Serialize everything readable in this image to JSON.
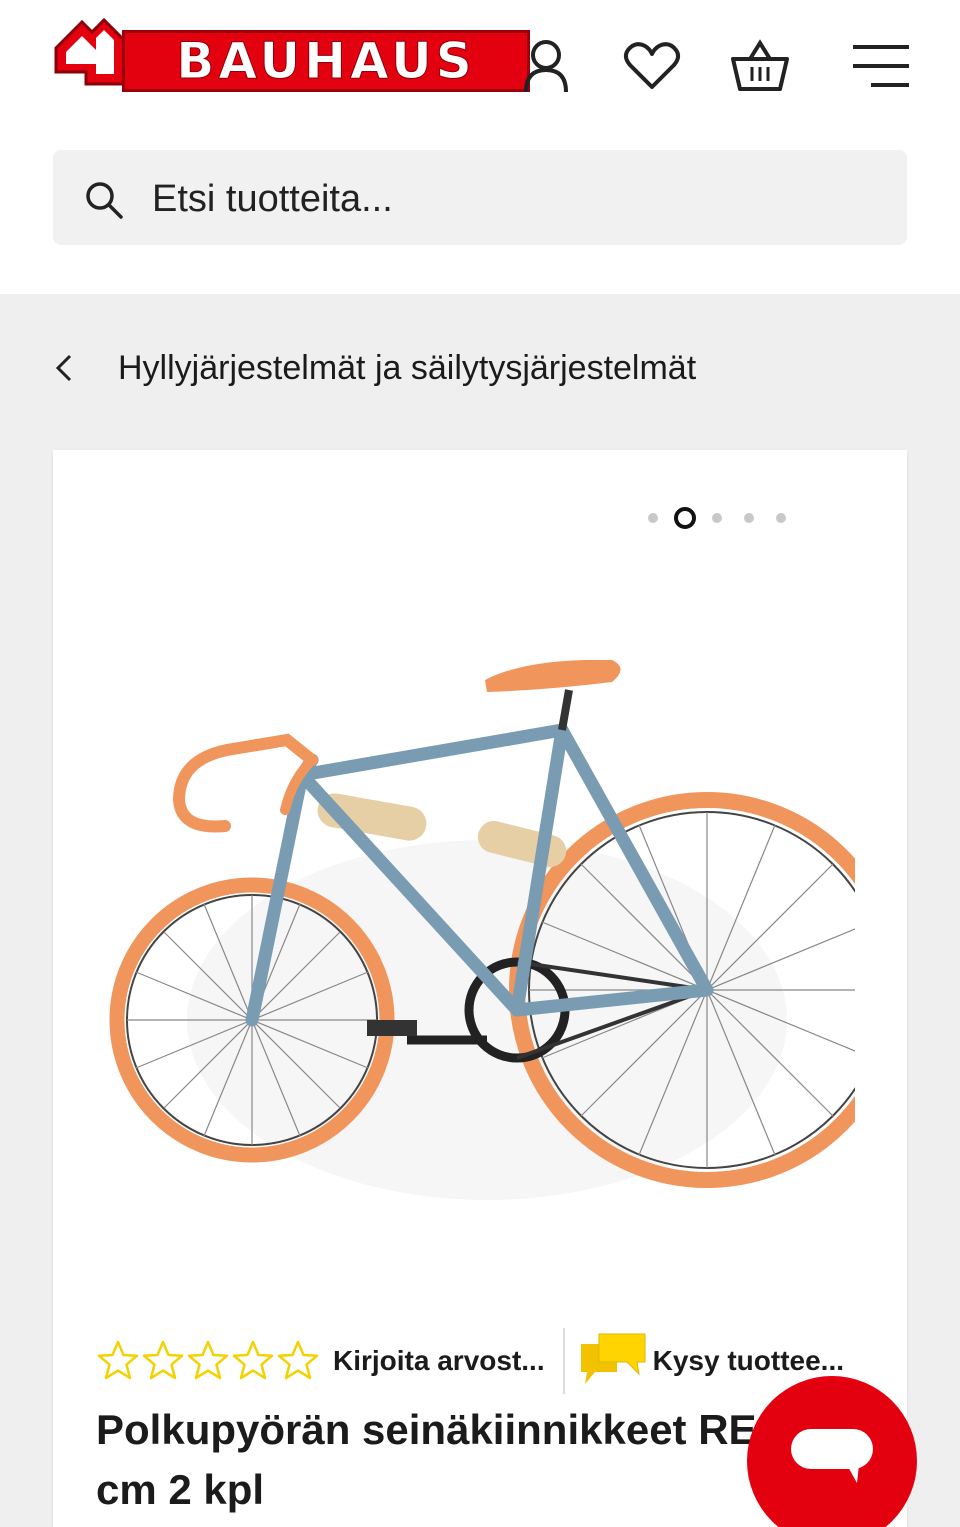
{
  "header": {
    "logo_text": "BAUHAUS",
    "icons": [
      "user-icon",
      "heart-icon",
      "basket-icon",
      "menu-icon"
    ]
  },
  "search": {
    "placeholder": "Etsi tuotteita..."
  },
  "breadcrumb": {
    "label": "Hyllyjärjestelmät ja säilytysjärjestelmät"
  },
  "gallery": {
    "total_images": 5,
    "active_index": 2
  },
  "product": {
    "rating_stars": 0,
    "rating_max": 5,
    "review_link": "Kirjoita arvost...",
    "question_link": "Kysy tuottee...",
    "title": "Polkupyörän seinäkiinnikkeet RE 39 cm 2 kpl"
  },
  "colors": {
    "brand_red": "#e3000f",
    "star_yellow": "#f2d200",
    "bike_frame": "#7a9cb3",
    "bike_tire": "#f0955b"
  }
}
